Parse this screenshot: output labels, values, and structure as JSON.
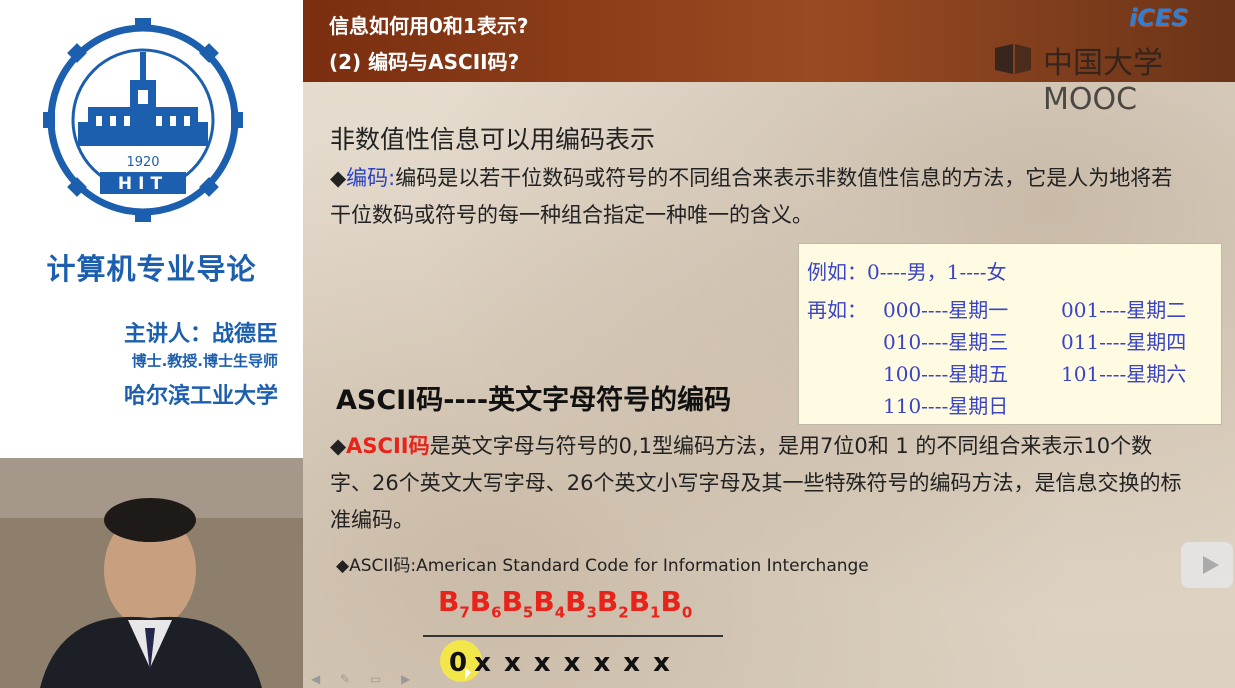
{
  "left": {
    "logo_year": "1920",
    "logo_abbrev": "HIT",
    "course_title": "计算机专业导论",
    "lecturer": "主讲人：战德臣",
    "lecturer_title": "博士.教授.博士生导师",
    "university": "哈尔滨工业大学"
  },
  "slide": {
    "header_line1": "信息如何用0和1表示?",
    "header_line2": "(2) 编码与ASCII码?",
    "ces_logo": "iCES",
    "mooc_logo": "中国大学MOOC",
    "heading1": "非数值性信息可以用编码表示",
    "p1_bullet": "◆",
    "p1_term": "编码:",
    "p1_text": "编码是以若干位数码或符号的不同组合来表示非数值性信息的方法，它是人为地将若干位数码或符号的每一种组合指定一种唯一的含义。",
    "example": {
      "line1": "例如：0----男，1----女",
      "label2": "再如：",
      "items": [
        "000----星期一",
        "001----星期二",
        "010----星期三",
        "011----星期四",
        "100----星期五",
        "101----星期六",
        "110----星期日"
      ]
    },
    "heading2": "ASCII码----英文字母符号的编码",
    "p2_bullet": "◆",
    "p2_term": "ASCII码",
    "p2_text": "是英文字母与符号的0,1型编码方法，是用7位0和 1 的不同组合来表示10个数字、26个英文大写字母、26个英文小写字母及其一些特殊符号的编码方法，是信息交换的标准编码。",
    "p3": "◆ASCII码:American Standard Code for Information Interchange",
    "bits": [
      {
        "b": "B",
        "s": "7"
      },
      {
        "b": "B",
        "s": "6"
      },
      {
        "b": "B",
        "s": "5"
      },
      {
        "b": "B",
        "s": "4"
      },
      {
        "b": "B",
        "s": "3"
      },
      {
        "b": "B",
        "s": "2"
      },
      {
        "b": "B",
        "s": "1"
      },
      {
        "b": "B",
        "s": "0"
      }
    ],
    "first_bit": "0",
    "x_bits": "x x x x x x x"
  },
  "colors": {
    "blue": "#1c5fae",
    "header_bg": "#7a2e0f",
    "red": "#e8231a"
  }
}
